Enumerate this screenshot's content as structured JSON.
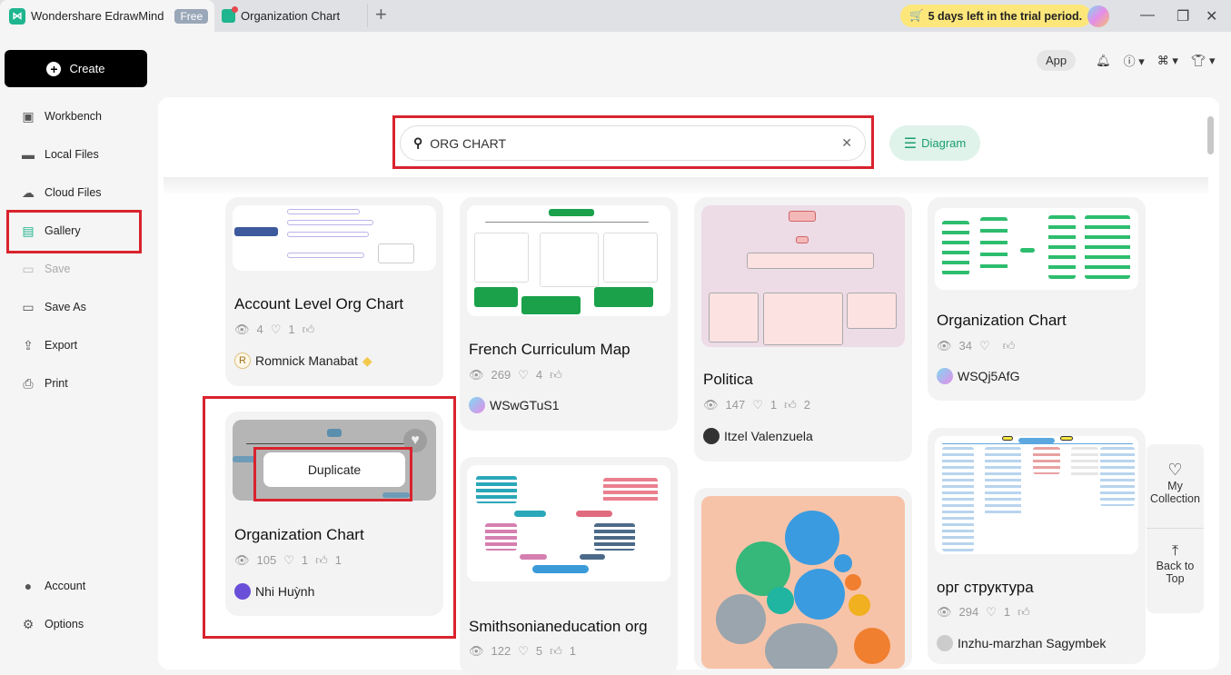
{
  "titlebar": {
    "app_name": "Wondershare EdrawMind",
    "badge": "Free",
    "doc_tab": "Organization Chart",
    "new_tab": "+",
    "trial": "5 days left in the trial period.",
    "minimize": "—",
    "maximize": "❐",
    "close": "✕"
  },
  "sidebar": {
    "create": "Create",
    "items": [
      {
        "label": "Workbench",
        "icon": "workbench-icon"
      },
      {
        "label": "Local Files",
        "icon": "folder-icon"
      },
      {
        "label": "Cloud Files",
        "icon": "cloud-icon"
      },
      {
        "label": "Gallery",
        "icon": "gallery-icon",
        "active": true
      },
      {
        "label": "Save",
        "icon": "save-icon",
        "disabled": true
      },
      {
        "label": "Save As",
        "icon": "save-as-icon"
      },
      {
        "label": "Export",
        "icon": "export-icon"
      },
      {
        "label": "Print",
        "icon": "print-icon"
      }
    ],
    "bottom": [
      {
        "label": "Account",
        "icon": "account-icon"
      },
      {
        "label": "Options",
        "icon": "gear-icon"
      }
    ]
  },
  "toolbar": {
    "app": "App"
  },
  "search": {
    "value": "ORG CHART",
    "clear": "✕",
    "filter": "Diagram"
  },
  "cards": [
    {
      "title": "Account Level Org Chart",
      "views": "4",
      "favs": "1",
      "likes": "",
      "author": "Romnick Manabat",
      "initial": "R"
    },
    {
      "title": "Organization Chart",
      "views": "105",
      "favs": "1",
      "likes": "1",
      "author": "Nhi Huỳnh",
      "hover": "Duplicate"
    },
    {
      "title": "French Curriculum Map",
      "views": "269",
      "favs": "4",
      "likes": "",
      "author": "WSwGTuS1"
    },
    {
      "title": "Smithsonianeducation org",
      "views": "122",
      "favs": "5",
      "likes": "1"
    },
    {
      "title": "Politica",
      "views": "147",
      "favs": "1",
      "likes": "2",
      "author": "Itzel Valenzuela"
    },
    {
      "title": "Organization Chart",
      "views": "34",
      "favs": "",
      "likes": "",
      "author": "WSQj5AfG"
    },
    {
      "title": "орг структура",
      "views": "294",
      "favs": "1",
      "likes": "",
      "author": "Inzhu-marzhan Sagymbek"
    }
  ],
  "float": {
    "collection": "My Collection",
    "top": "Back to Top"
  },
  "colors": {
    "accent": "#1fb58f",
    "highlight": "#d9232d",
    "trial": "#fde77b"
  }
}
